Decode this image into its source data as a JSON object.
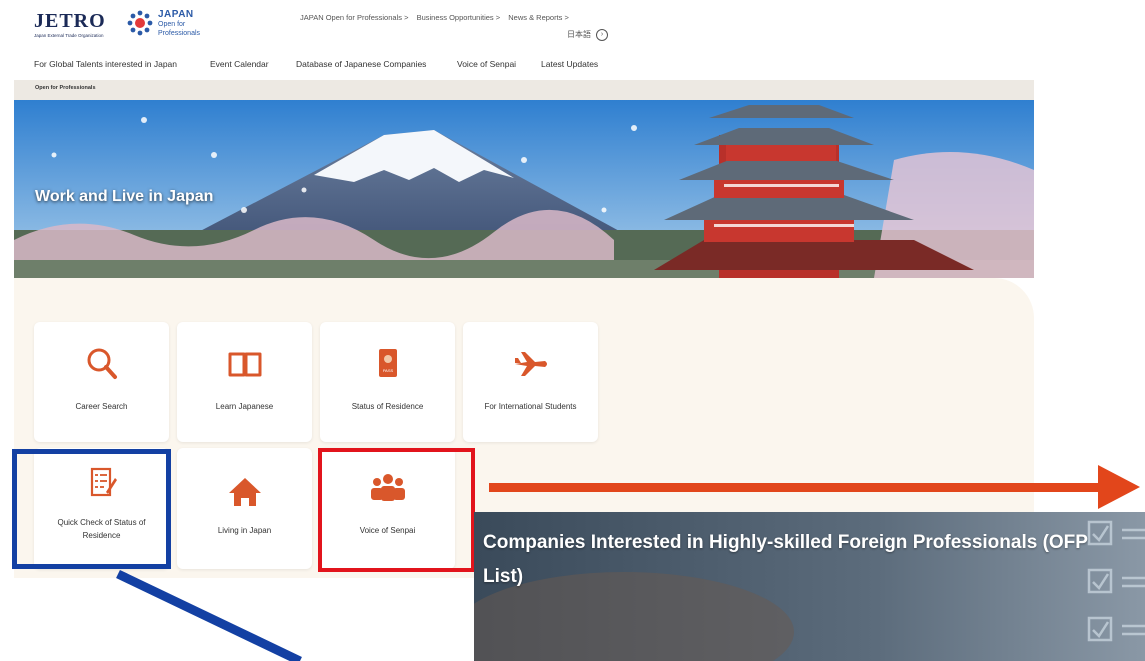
{
  "header": {
    "logo_jetro": "JETRO",
    "logo_jetro_sub": "Japan External Trade Organization",
    "logo_japan": "JAPAN",
    "logo_japan_sub1": "Open for",
    "logo_japan_sub2": "Professionals",
    "top_nav": [
      {
        "label": "JAPAN Open for Professionals >"
      },
      {
        "label": "Business Opportunities >"
      },
      {
        "label": "News & Reports >"
      }
    ],
    "language_label": "日本語",
    "language_icon": "circle-arrow-icon"
  },
  "main_nav": [
    {
      "label": "For Global Talents interested in Japan"
    },
    {
      "label": "Event Calendar"
    },
    {
      "label": "Database of Japanese Companies"
    },
    {
      "label": "Voice of Senpai"
    },
    {
      "label": "Latest Updates"
    }
  ],
  "breadcrumb": "Open for Professionals",
  "hero": {
    "title": "Work and Live in Japan"
  },
  "cards": [
    {
      "label": "Career Search",
      "icon": "search-icon"
    },
    {
      "label": "Learn Japanese",
      "icon": "book-icon"
    },
    {
      "label": "Status of Residence",
      "icon": "passport-icon",
      "icon_text": "PASS"
    },
    {
      "label": "For International Students",
      "icon": "airplane-icon"
    },
    {
      "label": "Quick Check of Status of Residence",
      "icon": "checklist-icon"
    },
    {
      "label": "Living in Japan",
      "icon": "home-icon"
    },
    {
      "label": "Voice of Senpai",
      "icon": "people-icon"
    }
  ],
  "banner": {
    "title": "Companies Interested in Highly-skilled Foreign Professionals (OFP List)"
  },
  "colors": {
    "accent": "#d9572b",
    "highlight_blue": "#1340a3",
    "highlight_red": "#e2141c",
    "arrow": "#e2461b"
  }
}
